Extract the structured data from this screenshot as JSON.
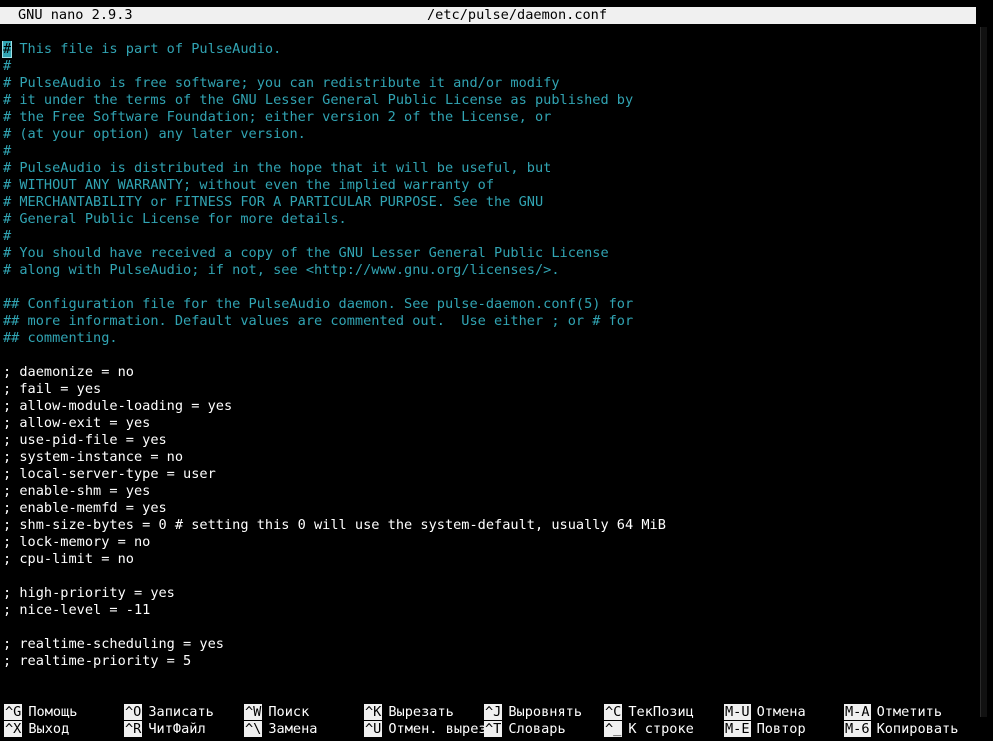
{
  "titlebar": {
    "app": "GNU nano 2.9.3",
    "file": "/etc/pulse/daemon.conf"
  },
  "editor": {
    "lines": [
      {
        "text": "# This file is part of PulseAudio.",
        "kind": "comment"
      },
      {
        "text": "#",
        "kind": "comment"
      },
      {
        "text": "# PulseAudio is free software; you can redistribute it and/or modify",
        "kind": "comment"
      },
      {
        "text": "# it under the terms of the GNU Lesser General Public License as published by",
        "kind": "comment"
      },
      {
        "text": "# the Free Software Foundation; either version 2 of the License, or",
        "kind": "comment"
      },
      {
        "text": "# (at your option) any later version.",
        "kind": "comment"
      },
      {
        "text": "#",
        "kind": "comment"
      },
      {
        "text": "# PulseAudio is distributed in the hope that it will be useful, but",
        "kind": "comment"
      },
      {
        "text": "# WITHOUT ANY WARRANTY; without even the implied warranty of",
        "kind": "comment"
      },
      {
        "text": "# MERCHANTABILITY or FITNESS FOR A PARTICULAR PURPOSE. See the GNU",
        "kind": "comment"
      },
      {
        "text": "# General Public License for more details.",
        "kind": "comment"
      },
      {
        "text": "#",
        "kind": "comment"
      },
      {
        "text": "# You should have received a copy of the GNU Lesser General Public License",
        "kind": "comment"
      },
      {
        "text": "# along with PulseAudio; if not, see <http://www.gnu.org/licenses/>.",
        "kind": "comment"
      },
      {
        "text": "",
        "kind": "text"
      },
      {
        "text": "## Configuration file for the PulseAudio daemon. See pulse-daemon.conf(5) for",
        "kind": "comment"
      },
      {
        "text": "## more information. Default values are commented out.  Use either ; or # for",
        "kind": "comment"
      },
      {
        "text": "## commenting.",
        "kind": "comment"
      },
      {
        "text": "",
        "kind": "text"
      },
      {
        "text": "; daemonize = no",
        "kind": "text"
      },
      {
        "text": "; fail = yes",
        "kind": "text"
      },
      {
        "text": "; allow-module-loading = yes",
        "kind": "text"
      },
      {
        "text": "; allow-exit = yes",
        "kind": "text"
      },
      {
        "text": "; use-pid-file = yes",
        "kind": "text"
      },
      {
        "text": "; system-instance = no",
        "kind": "text"
      },
      {
        "text": "; local-server-type = user",
        "kind": "text"
      },
      {
        "text": "; enable-shm = yes",
        "kind": "text"
      },
      {
        "text": "; enable-memfd = yes",
        "kind": "text"
      },
      {
        "text": "; shm-size-bytes = 0 # setting this 0 will use the system-default, usually 64 MiB",
        "kind": "text"
      },
      {
        "text": "; lock-memory = no",
        "kind": "text"
      },
      {
        "text": "; cpu-limit = no",
        "kind": "text"
      },
      {
        "text": "",
        "kind": "text"
      },
      {
        "text": "; high-priority = yes",
        "kind": "text"
      },
      {
        "text": "; nice-level = -11",
        "kind": "text"
      },
      {
        "text": "",
        "kind": "text"
      },
      {
        "text": "; realtime-scheduling = yes",
        "kind": "text"
      },
      {
        "text": "; realtime-priority = 5",
        "kind": "text"
      }
    ]
  },
  "shortcuts": {
    "row1": [
      {
        "key": "^G",
        "label": "Помощь"
      },
      {
        "key": "^O",
        "label": "Записать"
      },
      {
        "key": "^W",
        "label": "Поиск"
      },
      {
        "key": "^K",
        "label": "Вырезать"
      },
      {
        "key": "^J",
        "label": "Выровнять"
      },
      {
        "key": "^C",
        "label": "ТекПозиц"
      },
      {
        "key": "M-U",
        "label": "Отмена"
      },
      {
        "key": "M-A",
        "label": "Отметить"
      }
    ],
    "row2": [
      {
        "key": "^X",
        "label": "Выход"
      },
      {
        "key": "^R",
        "label": "ЧитФайл"
      },
      {
        "key": "^\\",
        "label": "Замена"
      },
      {
        "key": "^U",
        "label": "Отмен. вырез"
      },
      {
        "key": "^T",
        "label": "Словарь"
      },
      {
        "key": "^_",
        "label": "К строке"
      },
      {
        "key": "M-E",
        "label": "Повтор"
      },
      {
        "key": "M-6",
        "label": "Копировать"
      }
    ]
  },
  "colors": {
    "background": "#000000",
    "comment": "#31a4b3",
    "text": "#ffffff",
    "bar": "#f0f0f0"
  }
}
